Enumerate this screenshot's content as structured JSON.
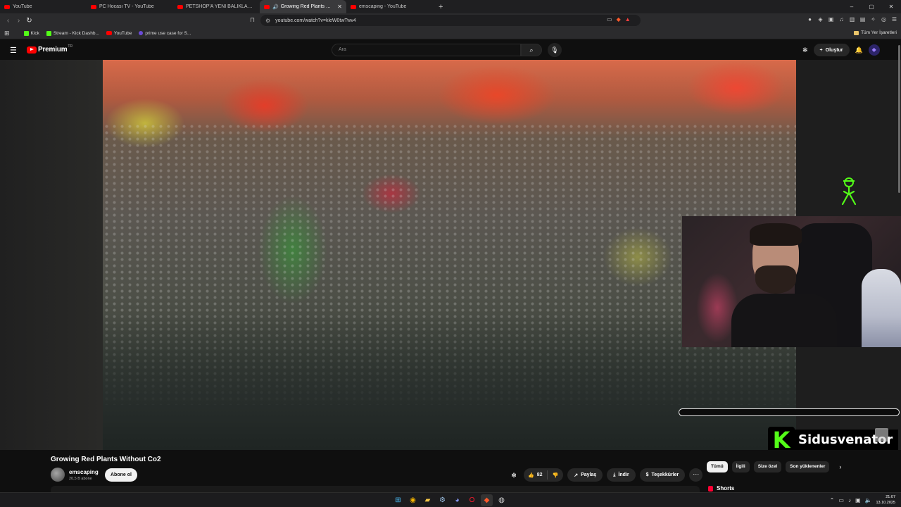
{
  "browser": {
    "tabs": [
      {
        "label": "YouTube",
        "active": false
      },
      {
        "label": "PC Hocası TV - YouTube",
        "active": false
      },
      {
        "label": "PETSHOP'A YENİ BALIKLAR GELDİ | S",
        "active": false
      },
      {
        "label": "Growing Red Plants Without",
        "active": true,
        "audio": true
      },
      {
        "label": "emscaping - YouTube",
        "active": false
      }
    ],
    "new_tab": "+",
    "window_controls": {
      "minimize": "–",
      "maximize": "▢",
      "close": "✕"
    },
    "url": "youtube.com/watch?v=kleW0twTwv4",
    "bookmarks": [
      {
        "label": "Kick",
        "icon": "kick-icon"
      },
      {
        "label": "Stream - Kick Dashb...",
        "icon": "kick-icon"
      },
      {
        "label": "YouTube",
        "icon": "youtube-icon"
      },
      {
        "label": "prime use case for S...",
        "icon": "prime-icon"
      }
    ],
    "all_bookmarks": "Tüm Yer İşaretleri"
  },
  "youtube": {
    "logo_text": "Premium",
    "region": "TR",
    "search_placeholder": "Ara",
    "create_label": "Oluştur"
  },
  "video": {
    "title": "Growing Red Plants Without Co2",
    "channel": "emscaping",
    "subscribers": "20,5 B abone",
    "subscribe_label": "Abone ol",
    "likes": "82",
    "share_label": "Paylaş",
    "download_label": "İndir",
    "thanks_label": "Teşekkürler"
  },
  "overlay": {
    "streamer_name": "Sidusvenator",
    "kick_letter": "K"
  },
  "sidebar": {
    "chips": [
      "Tümü",
      "İlgili",
      "Size özel",
      "Son yüklenenler"
    ],
    "shorts_label": "Shorts"
  },
  "taskbar": {
    "time": "21:07",
    "date": "13.10.2025"
  },
  "colors": {
    "youtube_red": "#ff0000",
    "kick_green": "#53fc18",
    "background": "#0f0f0f"
  }
}
